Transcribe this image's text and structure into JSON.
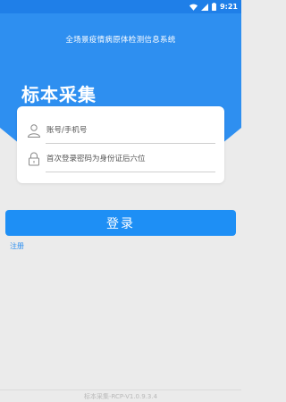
{
  "status_bar": {
    "time": "9:21",
    "icons": [
      "wifi-icon",
      "cellular-signal-icon",
      "battery-icon"
    ]
  },
  "header": {
    "system_title": "全场景疫情病原体检测信息系统",
    "page_title": "标本采集"
  },
  "login_form": {
    "account_placeholder": "账号/手机号",
    "account_value": "",
    "password_placeholder": "首次登录密码为身份证后六位",
    "password_value": "",
    "account_icon": "user-icon",
    "password_icon": "lock-icon"
  },
  "actions": {
    "login_label": "登录",
    "register_label": "注册"
  },
  "footer": {
    "version": "标本采集-RCP-V1.0.9.3.4"
  },
  "colors": {
    "primary": "#2e8ff0",
    "status_bar": "#1f7fe8",
    "button": "#1e8ff5",
    "background": "#ebebeb"
  }
}
